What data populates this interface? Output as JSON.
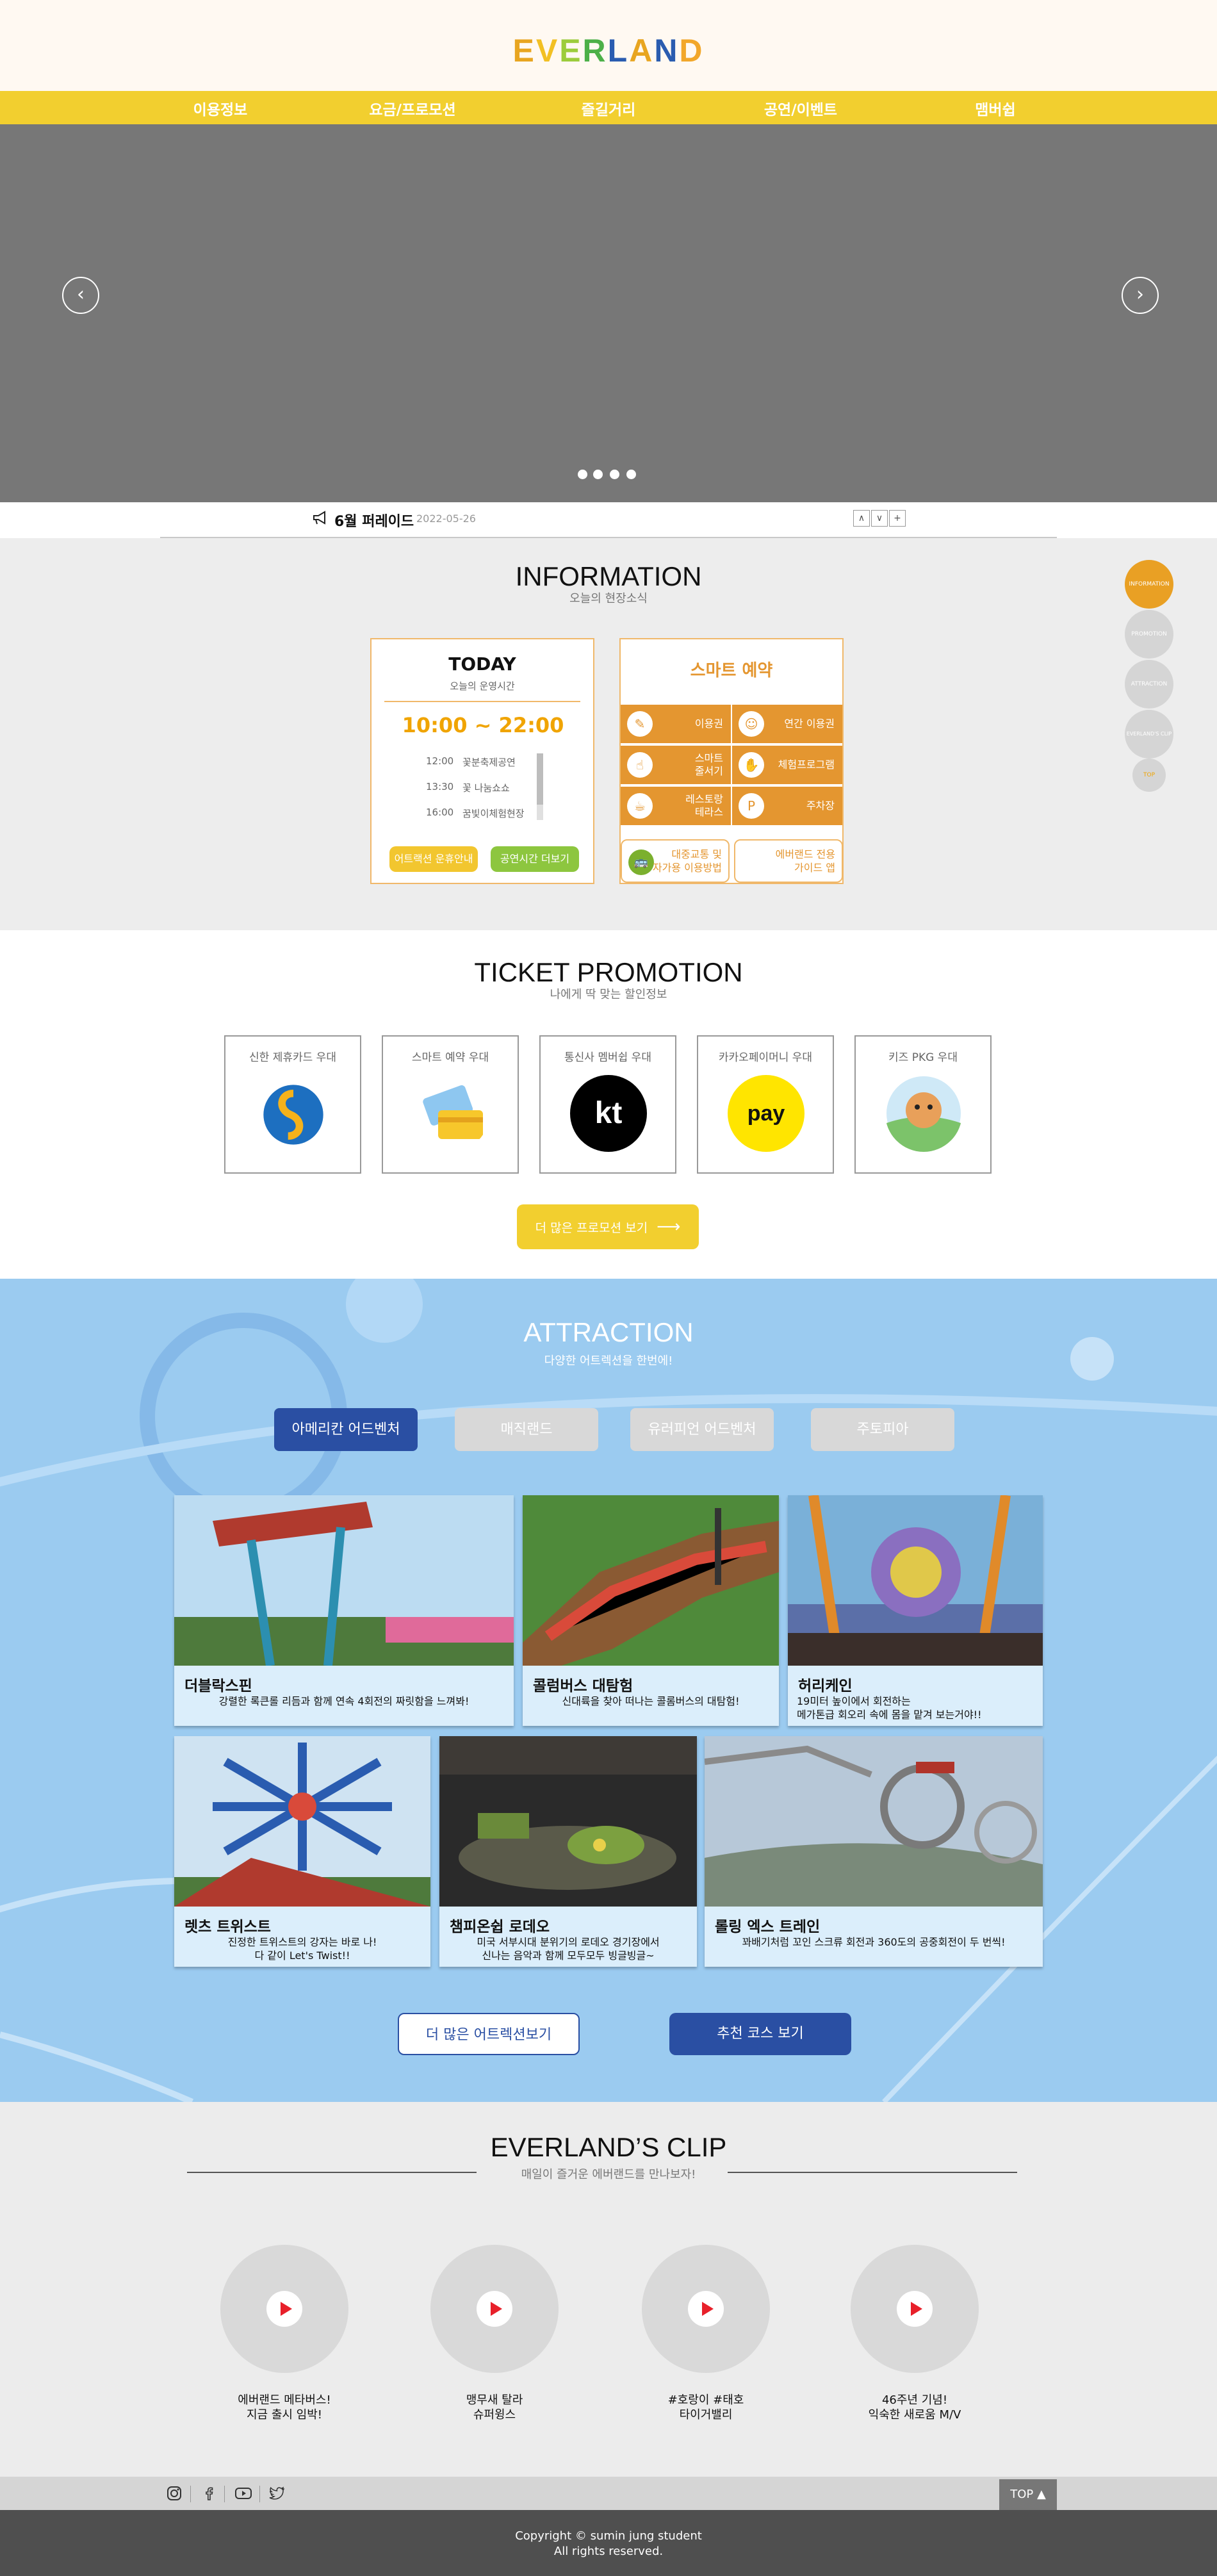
{
  "header": {
    "logo_letters": [
      {
        "ch": "E",
        "color": "#e8a520"
      },
      {
        "ch": "V",
        "color": "#f2c024"
      },
      {
        "ch": "E",
        "color": "#9ccc3c"
      },
      {
        "ch": "R",
        "color": "#4cb048"
      },
      {
        "ch": "L",
        "color": "#2a5cb0"
      },
      {
        "ch": "A",
        "color": "#e8a520"
      },
      {
        "ch": "N",
        "color": "#2a5cb0"
      },
      {
        "ch": "D",
        "color": "#f2a72a"
      }
    ]
  },
  "nav": {
    "items": [
      "이용정보",
      "요금/프로모션",
      "즐길거리",
      "공연/이벤트",
      "맴버쉽"
    ]
  },
  "hero": {
    "prev_icon": "chevron-left-icon",
    "next_icon": "chevron-right-icon",
    "slide_count": 4
  },
  "notice": {
    "text": "6월 퍼레이드",
    "date": "2022-05-26",
    "buttons": [
      "∧",
      "∨",
      "+"
    ]
  },
  "information": {
    "title": "INFORMATION",
    "subtitle": "오늘의 현장소식",
    "today": {
      "title": "TODAY",
      "subtitle": "오늘의 운영시간",
      "hours": "10:00 ~ 22:00",
      "schedule": [
        {
          "time": "12:00",
          "event": "꽃분축제공연"
        },
        {
          "time": "13:30",
          "event": "꽃 나눔쇼쇼"
        },
        {
          "time": "16:00",
          "event": "꿈빛이체험현장"
        }
      ],
      "btn_attraction": "어트랙션 운휴안내",
      "btn_show": "공연시간 더보기"
    },
    "smart": {
      "title": "스마트 예약",
      "cells": [
        {
          "label": "이용권",
          "icon": "ticket-icon"
        },
        {
          "label": "연간 이용권",
          "icon": "people-icon"
        },
        {
          "label": "스마트\n줄서기",
          "icon": "queue-icon"
        },
        {
          "label": "체험프로그램",
          "icon": "hand-icon"
        },
        {
          "label": "레스토랑\n테라스",
          "icon": "restaurant-icon"
        },
        {
          "label": "주차장",
          "icon": "parking-icon"
        }
      ],
      "bottom_left": "대중교통 및\n자가용 이용방법",
      "bottom_right": "에버랜드 전용\n가이드 앱"
    },
    "side_menu": [
      "INFORMATION",
      "PROMOTION",
      "ATTRACTION",
      "EVERLAND'S CLIP",
      "TOP"
    ]
  },
  "promotion": {
    "title": "TICKET PROMOTION",
    "subtitle": "나에게 딱 맞는 할인정보",
    "items": [
      "신한 제휴카드 우대",
      "스마트 예약 우대",
      "통신사 멤버쉽 우대",
      "카카오페이머니 우대",
      "키즈 PKG 우대"
    ],
    "pay_label": "pay",
    "kt_label": "kt",
    "more_button": "더 많은 프로모션 보기"
  },
  "attraction": {
    "title": "ATTRACTION",
    "subtitle": "다양한 어트렉션을 한번에!",
    "tabs": [
      "아메리칸 어드벤처",
      "매직랜드",
      "유러피언 어드벤처",
      "주토피아"
    ],
    "cards": [
      {
        "name": "더블락스핀",
        "desc": "강렬한 록큰롤 리듬과 함께 연속 4회전의 짜릿함을 느껴봐!"
      },
      {
        "name": "콜럼버스 대탐험",
        "desc": "신대륙을 찾아 떠나는 콜롬버스의 대탐험!"
      },
      {
        "name": "허리케인",
        "desc": "19미터 높이에서 회전하는\n                    메가톤급 회오리 속에 몸을 맡겨 보는거야!!"
      },
      {
        "name": "렛츠 트위스트",
        "desc": "진정한 트위스트의 강자는 바로 나!\n                  다 같이 Let's Twist!!"
      },
      {
        "name": "챔피온쉽 로데오",
        "desc": "미국 서부시대 분위기의 로데오 경기장에서\n신나는 음악과 함께 모두모두 빙글빙글~"
      },
      {
        "name": "롤링 엑스 트레인",
        "desc": "꽈배기처럼 꼬인 스크류 회전과 360도의 공중회전이 두 번씩!"
      }
    ],
    "more_button": "더 많은 어트렉션보기",
    "course_button": "추천 코스 보기"
  },
  "clip": {
    "title": "EVERLAND’S CLIP",
    "subtitle": "매일이 즐거운 에버랜드를 만나보자!",
    "items": [
      "에버랜드 메타버스!\n지금 출시 임박!",
      "맹무새 탈라\n슈퍼윙스",
      "#호랑이 #태호\n타이거밸리",
      "46주년 기념!\n익숙한 새로움 M/V"
    ]
  },
  "sns": {
    "icons": [
      "instagram-icon",
      "facebook-icon",
      "youtube-icon",
      "twitter-icon"
    ],
    "top_label": "TOP ▲"
  },
  "footer": {
    "line1": "Copyright © sumin jung student",
    "line2": "All rights reserved."
  },
  "colors": {
    "yellow": "#f2cf2f",
    "orange": "#e49630",
    "blue": "#2a4fa3",
    "sky": "#9bcbf0"
  }
}
